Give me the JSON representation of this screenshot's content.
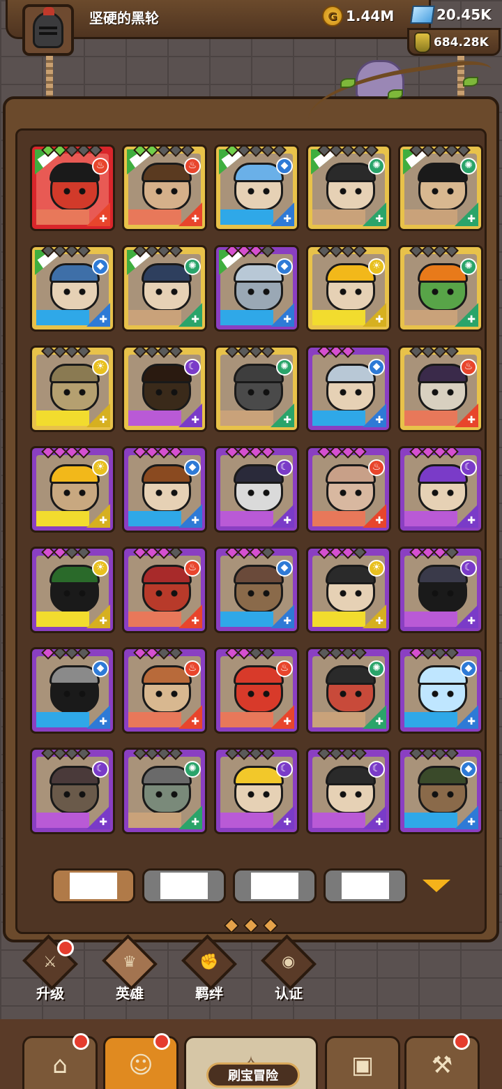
{
  "player": {
    "name": "坚硬的黑轮"
  },
  "resources": {
    "gold": "1.44M",
    "gems": "20.45K",
    "essence": "684.28K"
  },
  "heroes": [
    {
      "frame": "red",
      "elem": "fire",
      "stars": [
        "green",
        "green",
        "off",
        "off",
        "off"
      ],
      "tag": true,
      "hair": "#1a1a1a",
      "skin": "#d23a2a"
    },
    {
      "frame": "gold",
      "elem": "fire",
      "stars": [
        "green",
        "green",
        "off",
        "off",
        "off"
      ],
      "tag": true,
      "hair": "#5a3a20",
      "skin": "#d5b08a"
    },
    {
      "frame": "gold",
      "elem": "water",
      "stars": [
        "green",
        "off",
        "off",
        "off",
        "off"
      ],
      "tag": true,
      "hair": "#6ab0e8",
      "skin": "#e6d1b5"
    },
    {
      "frame": "gold",
      "elem": "wind",
      "stars": [
        "off",
        "off",
        "off",
        "off",
        "off"
      ],
      "tag": true,
      "hair": "#2a2a2a",
      "skin": "#e6d1b5"
    },
    {
      "frame": "gold",
      "elem": "wind",
      "stars": [
        "off",
        "off",
        "off",
        "off",
        "off"
      ],
      "tag": true,
      "hair": "#1a1a1a",
      "skin": "#d8b890"
    },
    {
      "frame": "gold",
      "elem": "water",
      "stars": [
        "off",
        "off",
        "off",
        "off"
      ],
      "tag": true,
      "hair": "#3e6fa8",
      "skin": "#e6d1b5"
    },
    {
      "frame": "gold",
      "elem": "wind",
      "stars": [
        "off",
        "off",
        "off",
        "off"
      ],
      "tag": true,
      "hair": "#2e3f5e",
      "skin": "#e6d1b5"
    },
    {
      "frame": "purple",
      "elem": "water",
      "stars": [
        "purple",
        "purple",
        "purple",
        "off"
      ],
      "tag": true,
      "hair": "#b8c8d6",
      "skin": "#9aa8b5"
    },
    {
      "frame": "gold",
      "elem": "light",
      "stars": [
        "off",
        "off",
        "off",
        "off"
      ],
      "tag": false,
      "hair": "#f2b81a",
      "skin": "#e6d1b5"
    },
    {
      "frame": "gold",
      "elem": "wind",
      "stars": [
        "off",
        "off",
        "off",
        "off"
      ],
      "tag": false,
      "hair": "#e87a1a",
      "skin": "#58a448"
    },
    {
      "frame": "gold",
      "elem": "light",
      "stars": [
        "off",
        "off",
        "off",
        "off"
      ],
      "tag": false,
      "hair": "#8a7a52",
      "skin": "#b5a070"
    },
    {
      "frame": "gold",
      "elem": "dark",
      "stars": [
        "off",
        "off",
        "off",
        "off"
      ],
      "tag": false,
      "hair": "#2a1a10",
      "skin": "#3a2a1a"
    },
    {
      "frame": "gold",
      "elem": "wind",
      "stars": [
        "off",
        "off",
        "off",
        "off"
      ],
      "tag": false,
      "hair": "#3e3e3e",
      "skin": "#4a4a4a"
    },
    {
      "frame": "purple",
      "elem": "water",
      "stars": [
        "purple",
        "purple",
        "purple"
      ],
      "tag": false,
      "hair": "#b8c8d6",
      "skin": "#e6d1b5"
    },
    {
      "frame": "gold",
      "elem": "fire",
      "stars": [
        "off",
        "off",
        "off",
        "off"
      ],
      "tag": false,
      "hair": "#3a2a4a",
      "skin": "#d8d0c0"
    },
    {
      "frame": "purple",
      "elem": "light",
      "stars": [
        "purple",
        "purple",
        "purple",
        "purple"
      ],
      "tag": false,
      "hair": "#f2b81a",
      "skin": "#c8a880"
    },
    {
      "frame": "purple",
      "elem": "water",
      "stars": [
        "purple",
        "purple",
        "purple",
        "purple"
      ],
      "tag": false,
      "hair": "#8a4a20",
      "skin": "#e6d1b5"
    },
    {
      "frame": "purple",
      "elem": "dark",
      "stars": [
        "purple",
        "purple",
        "purple",
        "purple"
      ],
      "tag": false,
      "hair": "#2a2a3a",
      "skin": "#dadada"
    },
    {
      "frame": "purple",
      "elem": "fire",
      "stars": [
        "purple",
        "purple",
        "purple",
        "purple"
      ],
      "tag": false,
      "hair": "#c8a088",
      "skin": "#d8b8a0"
    },
    {
      "frame": "purple",
      "elem": "dark",
      "stars": [
        "purple",
        "purple",
        "purple",
        "purple"
      ],
      "tag": false,
      "hair": "#7a3bc8",
      "skin": "#e6d1b5"
    },
    {
      "frame": "purple",
      "elem": "light",
      "stars": [
        "purple",
        "purple",
        "off",
        "off"
      ],
      "tag": false,
      "hair": "#2a6a2a",
      "skin": "#1a1a1a"
    },
    {
      "frame": "purple",
      "elem": "fire",
      "stars": [
        "purple",
        "purple",
        "purple",
        "off"
      ],
      "tag": false,
      "hair": "#a82a2a",
      "skin": "#b83a2a"
    },
    {
      "frame": "purple",
      "elem": "water",
      "stars": [
        "purple",
        "purple",
        "purple",
        "off"
      ],
      "tag": false,
      "hair": "#6a4a3a",
      "skin": "#8a6a4a"
    },
    {
      "frame": "purple",
      "elem": "light",
      "stars": [
        "purple",
        "purple",
        "purple",
        "off"
      ],
      "tag": false,
      "hair": "#2a2a2a",
      "skin": "#e6d1b5"
    },
    {
      "frame": "purple",
      "elem": "dark",
      "stars": [
        "purple",
        "purple",
        "purple",
        "off"
      ],
      "tag": false,
      "hair": "#3a3a4a",
      "skin": "#1a1a1a"
    },
    {
      "frame": "purple",
      "elem": "water",
      "stars": [
        "purple",
        "off",
        "off",
        "off"
      ],
      "tag": false,
      "hair": "#8a8a8a",
      "skin": "#1a1a1a"
    },
    {
      "frame": "purple",
      "elem": "fire",
      "stars": [
        "purple",
        "purple",
        "off",
        "off"
      ],
      "tag": false,
      "hair": "#b86a3a",
      "skin": "#d8b890"
    },
    {
      "frame": "purple",
      "elem": "fire",
      "stars": [
        "purple",
        "purple",
        "off",
        "off"
      ],
      "tag": false,
      "hair": "#d83a2a",
      "skin": "#d83a2a"
    },
    {
      "frame": "purple",
      "elem": "wind",
      "stars": [
        "off",
        "off",
        "off",
        "off"
      ],
      "tag": false,
      "hair": "#2a2a2a",
      "skin": "#c84a3a"
    },
    {
      "frame": "purple",
      "elem": "water",
      "stars": [
        "purple",
        "off",
        "off",
        "off"
      ],
      "tag": false,
      "hair": "#bfe6ff",
      "skin": "#bfe6ff"
    },
    {
      "frame": "purple",
      "elem": "dark",
      "stars": [
        "off",
        "off",
        "off",
        "off"
      ],
      "tag": false,
      "hair": "#4a3a3a",
      "skin": "#6a5a4a"
    },
    {
      "frame": "purple",
      "elem": "wind",
      "stars": [
        "off",
        "off",
        "off",
        "off"
      ],
      "tag": false,
      "hair": "#6a6a6a",
      "skin": "#7a8a7a"
    },
    {
      "frame": "purple",
      "elem": "dark",
      "stars": [
        "off",
        "off",
        "off",
        "off"
      ],
      "tag": false,
      "hair": "#f2c82a",
      "skin": "#e6d1b5"
    },
    {
      "frame": "purple",
      "elem": "dark",
      "stars": [
        "off",
        "off",
        "off",
        "off"
      ],
      "tag": false,
      "hair": "#2a2a2a",
      "skin": "#e6d1b5"
    },
    {
      "frame": "purple",
      "elem": "water",
      "stars": [
        "off",
        "off",
        "off",
        "off"
      ],
      "tag": false,
      "hair": "#3a4a2a",
      "skin": "#8a6a4a"
    }
  ],
  "filters": [
    "",
    "",
    "",
    ""
  ],
  "subtabs": [
    {
      "label": "升级",
      "icon": "sword-icon",
      "badge": true
    },
    {
      "label": "英雄",
      "icon": "hero-icon",
      "badge": false
    },
    {
      "label": "羁绊",
      "icon": "fist-icon",
      "badge": false
    },
    {
      "label": "认证",
      "icon": "eye-icon",
      "badge": false
    }
  ],
  "nav": {
    "adventure_label": "刷宝冒险"
  },
  "colors": {
    "accent": "#e08a20",
    "badge": "#e53d2e",
    "gold": "#f5c242"
  }
}
